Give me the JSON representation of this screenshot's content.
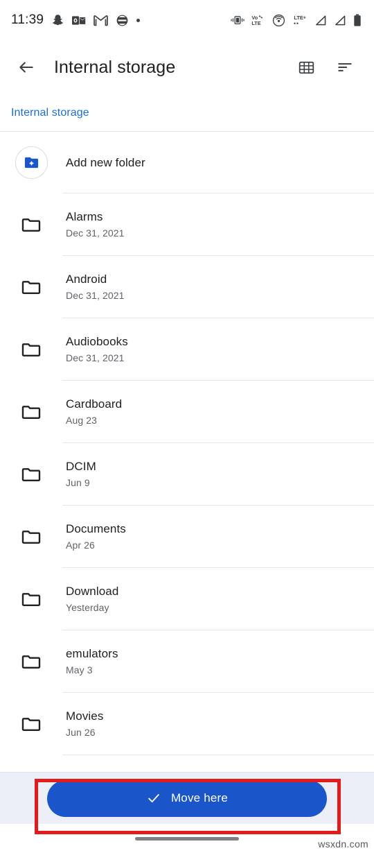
{
  "status_bar": {
    "time": "11:39",
    "left_icons": [
      "snapchat-icon",
      "outlook-icon",
      "gmail-icon",
      "app-icon",
      "overflow-dot"
    ],
    "right_icons": [
      "vibrate-icon",
      "volte-icon",
      "hotspot-icon",
      "lte-plus-icon",
      "signal-bars-icon",
      "signal-bars-2-icon",
      "battery-icon"
    ]
  },
  "app_bar": {
    "title": "Internal storage",
    "back_icon": "arrow-back-icon",
    "grid_icon": "grid-view-icon",
    "sort_icon": "sort-icon"
  },
  "breadcrumb": {
    "items": [
      {
        "label": "Internal storage"
      }
    ]
  },
  "list": {
    "add_new_folder": {
      "label": "Add new folder",
      "icon": "create-new-folder-icon"
    },
    "items": [
      {
        "name": "Alarms",
        "date": "Dec 31, 2021",
        "icon": "folder-icon"
      },
      {
        "name": "Android",
        "date": "Dec 31, 2021",
        "icon": "folder-icon"
      },
      {
        "name": "Audiobooks",
        "date": "Dec 31, 2021",
        "icon": "folder-icon"
      },
      {
        "name": "Cardboard",
        "date": "Aug 23",
        "icon": "folder-icon"
      },
      {
        "name": "DCIM",
        "date": "Jun 9",
        "icon": "folder-icon"
      },
      {
        "name": "Documents",
        "date": "Apr 26",
        "icon": "folder-icon"
      },
      {
        "name": "Download",
        "date": "Yesterday",
        "icon": "folder-icon"
      },
      {
        "name": "emulators",
        "date": "May 3",
        "icon": "folder-icon"
      },
      {
        "name": "Movies",
        "date": "Jun 26",
        "icon": "folder-icon"
      }
    ]
  },
  "bottom_bar": {
    "move_button_label": "Move here",
    "move_button_icon": "check-icon",
    "move_button_color": "#1a56c9"
  },
  "annotation": {
    "color": "#e41b1b"
  },
  "footer": {
    "watermark": "wsxdn.com"
  }
}
